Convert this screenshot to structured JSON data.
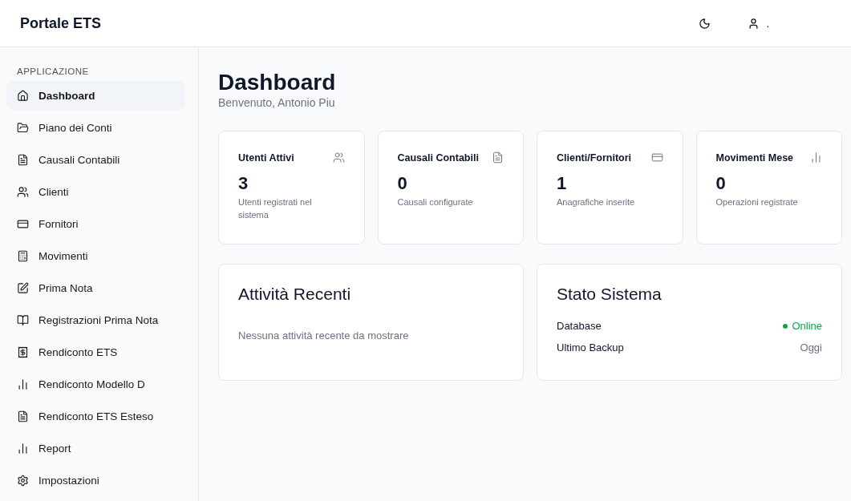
{
  "header": {
    "title": "Portale ETS",
    "user_name": "."
  },
  "sidebar": {
    "section": "APPLICAZIONE",
    "items": [
      {
        "label": "Dashboard",
        "selected": true
      },
      {
        "label": "Piano dei Conti",
        "selected": false
      },
      {
        "label": "Causali Contabili",
        "selected": false
      },
      {
        "label": "Clienti",
        "selected": false
      },
      {
        "label": "Fornitori",
        "selected": false
      },
      {
        "label": "Movimenti",
        "selected": false
      },
      {
        "label": "Prima Nota",
        "selected": false
      },
      {
        "label": "Registrazioni Prima Nota",
        "selected": false
      },
      {
        "label": "Rendiconto ETS",
        "selected": false
      },
      {
        "label": "Rendiconto Modello D",
        "selected": false
      },
      {
        "label": "Rendiconto ETS Esteso",
        "selected": false
      },
      {
        "label": "Report",
        "selected": false
      },
      {
        "label": "Impostazioni",
        "selected": false
      }
    ]
  },
  "page": {
    "title": "Dashboard",
    "subtitle": "Benvenuto, Antonio Piu"
  },
  "stats": [
    {
      "title": "Utenti Attivi",
      "value": "3",
      "caption": "Utenti registrati nel sistema"
    },
    {
      "title": "Causali Contabili",
      "value": "0",
      "caption": "Causali configurate"
    },
    {
      "title": "Clienti/Fornitori",
      "value": "1",
      "caption": "Anagrafiche inserite"
    },
    {
      "title": "Movimenti Mese",
      "value": "0",
      "caption": "Operazioni registrate"
    }
  ],
  "recent": {
    "title": "Attività Recenti",
    "empty": "Nessuna attività recente da mostrare"
  },
  "system": {
    "title": "Stato Sistema",
    "rows": [
      {
        "label": "Database",
        "value": "Online",
        "kind": "status",
        "color": "#16a34a"
      },
      {
        "label": "Ultimo Backup",
        "value": "Oggi",
        "kind": "plain"
      }
    ]
  }
}
